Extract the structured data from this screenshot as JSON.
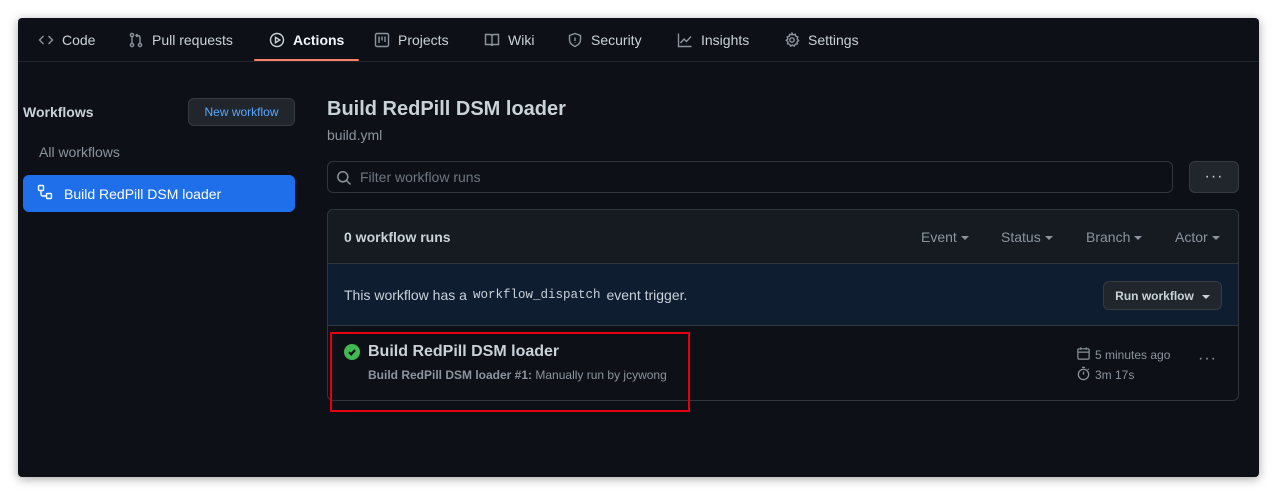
{
  "nav": {
    "tabs": [
      {
        "label": "Code",
        "icon": "code-icon"
      },
      {
        "label": "Pull requests",
        "icon": "pull-request-icon"
      },
      {
        "label": "Actions",
        "icon": "play-icon",
        "active": true
      },
      {
        "label": "Projects",
        "icon": "project-icon"
      },
      {
        "label": "Wiki",
        "icon": "book-icon"
      },
      {
        "label": "Security",
        "icon": "shield-icon"
      },
      {
        "label": "Insights",
        "icon": "graph-icon"
      },
      {
        "label": "Settings",
        "icon": "gear-icon"
      }
    ]
  },
  "sidebar": {
    "title": "Workflows",
    "new_workflow": "New workflow",
    "all_workflows": "All workflows",
    "items": [
      {
        "label": "Build RedPill DSM loader",
        "icon": "workflow-icon",
        "selected": true
      }
    ]
  },
  "main": {
    "title": "Build RedPill DSM loader",
    "filename": "build.yml",
    "filter_placeholder": "Filter workflow runs",
    "more_label": "···",
    "runs": {
      "count": "0 workflow runs",
      "filters": [
        "Event",
        "Status",
        "Branch",
        "Actor"
      ],
      "dispatch": {
        "prefix": "This workflow has a",
        "code": "workflow_dispatch",
        "suffix": "event trigger.",
        "button": "Run workflow"
      },
      "items": [
        {
          "title": "Build RedPill DSM loader",
          "meta_bold": "Build RedPill DSM loader #1:",
          "meta_rest": "Manually run by jcywong",
          "time": "5 minutes ago",
          "duration": "3m 17s",
          "status": "success",
          "more_label": "···"
        }
      ]
    }
  },
  "colors": {
    "background": "#0d1117",
    "accent": "#1f6feb",
    "tab_underline": "#f78166",
    "success": "#3fb950",
    "highlight_box": "#e4000f"
  }
}
